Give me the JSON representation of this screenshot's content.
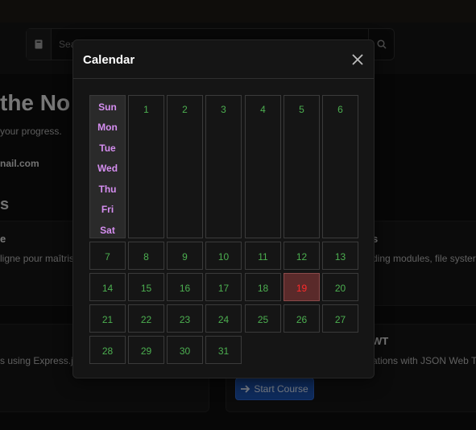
{
  "search": {
    "placeholder": "Sea"
  },
  "hero": {
    "title": "the No",
    "progress": "your progress.",
    "email": "nail.com"
  },
  "section": {
    "heading": "s"
  },
  "cards": [
    {
      "title": "e",
      "desc": "ligne pour maîtris"
    },
    {
      "title": "s",
      "desc": "ding modules, file syster"
    },
    {
      "title": "",
      "desc": "s using Express.js"
    },
    {
      "title": "WT",
      "desc": "ations with JSON Web To"
    }
  ],
  "start_course": {
    "label": "Start Course",
    "icon": "arrow-right-icon"
  },
  "modal": {
    "title": "Calendar",
    "close_icon": "close-icon"
  },
  "calendar": {
    "day_names": [
      "Sun",
      "Mon",
      "Tue",
      "Wed",
      "Thu",
      "Fri",
      "Sat"
    ],
    "weeks": [
      [
        "1",
        "2",
        "3",
        "4",
        "5",
        "6"
      ],
      [
        "7",
        "8",
        "9",
        "10",
        "11",
        "12",
        "13"
      ],
      [
        "14",
        "15",
        "16",
        "17",
        "18",
        "19",
        "20"
      ],
      [
        "21",
        "22",
        "23",
        "24",
        "25",
        "26",
        "27"
      ],
      [
        "28",
        "29",
        "30",
        "31"
      ]
    ],
    "today": "19",
    "colors": {
      "date": "#4caf50",
      "today": "#ff2b2b",
      "day_names": "#d58ef0"
    }
  }
}
